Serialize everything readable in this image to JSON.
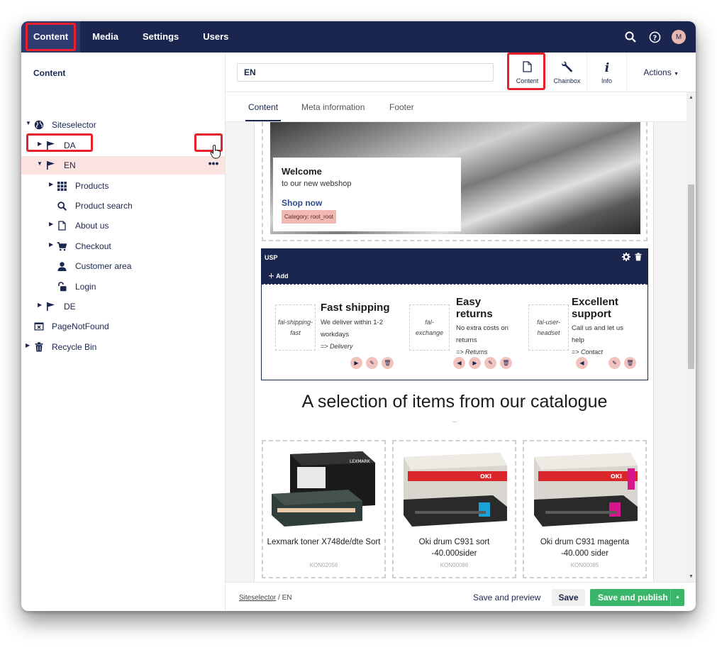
{
  "topnav": {
    "items": [
      "Content",
      "Media",
      "Settings",
      "Users"
    ],
    "avatar": "M"
  },
  "sidebar": {
    "title": "Content",
    "tree": {
      "root": "Siteselector",
      "da": "DA",
      "en": "EN",
      "children": [
        "Products",
        "Product search",
        "About us",
        "Checkout",
        "Customer area",
        "Login"
      ],
      "de": "DE",
      "notfound": "PageNotFound",
      "recycle": "Recycle Bin"
    }
  },
  "header": {
    "name_value": "EN",
    "buttons": [
      "Content",
      "Chainbox",
      "Info"
    ],
    "actions": "Actions"
  },
  "tabs": [
    "Content",
    "Meta information",
    "Footer"
  ],
  "hero": {
    "title": "Welcome",
    "subtitle": "to our new webshop",
    "link": "Shop now",
    "tag": "Category: root_root"
  },
  "usp": {
    "title": "USP",
    "add": "Add",
    "items": [
      {
        "icon": "fal-shipping-fast",
        "heading": "Fast shipping",
        "desc": "We deliver within 1-2 workdays",
        "link": "=> Delivery"
      },
      {
        "icon": "fal-exchange",
        "heading": "Easy returns",
        "desc": "No extra costs on returns",
        "link": "=> Returns"
      },
      {
        "icon": "fal-user-headset",
        "heading": "Excellent support",
        "desc": "Call us and let us help",
        "link": "=> Contact"
      }
    ]
  },
  "catalogue": {
    "title": "A selection of items from our catalogue",
    "dots": "...",
    "products": [
      {
        "name": "Lexmark toner X748de/dte Sort",
        "sku": "KON02056",
        "brand": "LEXMARK",
        "accent": "#1a1a1a"
      },
      {
        "name": "Oki drum C931 sort -40.000sider",
        "sku": "KON00086",
        "brand": "OKI",
        "accent": "#1aa3d8"
      },
      {
        "name": "Oki drum C931 magenta -40.000 sider",
        "sku": "KON00085",
        "brand": "OKI",
        "accent": "#d6168c"
      }
    ]
  },
  "footer": {
    "crumb_root": "Siteselector",
    "crumb_sep": "/",
    "crumb_current": "EN",
    "save_preview": "Save and preview",
    "save": "Save",
    "publish": "Save and publish"
  },
  "colors": {
    "navy": "#1b264f",
    "highlight": "#e8202a",
    "selected_row": "#fbe3e1",
    "publish": "#3ab56a"
  }
}
